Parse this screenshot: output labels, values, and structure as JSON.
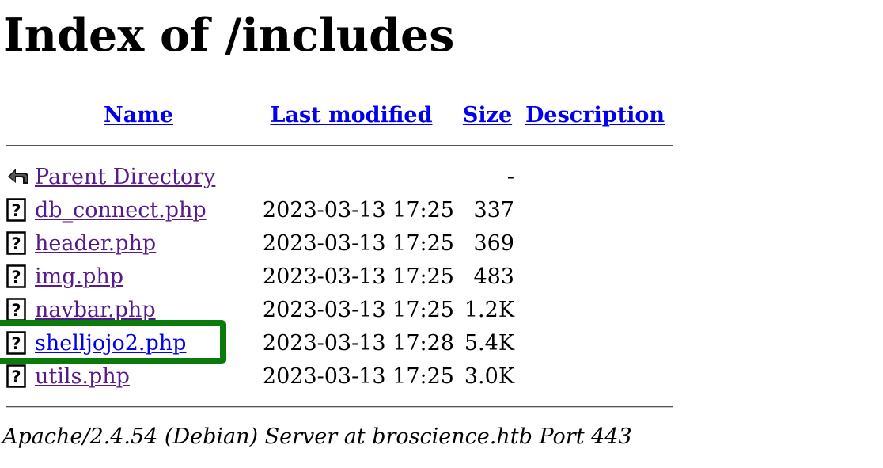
{
  "page": {
    "title": "Index of /includes"
  },
  "columns": {
    "name": "Name",
    "last_modified": "Last modified",
    "size": "Size",
    "description": "Description"
  },
  "rows": [
    {
      "icon": "back-arrow-icon",
      "name": "Parent Directory",
      "last_modified": "",
      "size": "-",
      "description": ""
    },
    {
      "icon": "unknown-file-icon",
      "name": "db_connect.php",
      "last_modified": "2023-03-13 17:25",
      "size": "337",
      "description": ""
    },
    {
      "icon": "unknown-file-icon",
      "name": "header.php",
      "last_modified": "2023-03-13 17:25",
      "size": "369",
      "description": ""
    },
    {
      "icon": "unknown-file-icon",
      "name": "img.php",
      "last_modified": "2023-03-13 17:25",
      "size": "483",
      "description": ""
    },
    {
      "icon": "unknown-file-icon",
      "name": "navbar.php",
      "last_modified": "2023-03-13 17:25",
      "size": "1.2K",
      "description": ""
    },
    {
      "icon": "unknown-file-icon",
      "name": "shelljojo2.php",
      "last_modified": "2023-03-13 17:28",
      "size": "5.4K",
      "description": ""
    },
    {
      "icon": "unknown-file-icon",
      "name": "utils.php",
      "last_modified": "2023-03-13 17:25",
      "size": "3.0K",
      "description": ""
    }
  ],
  "footer": {
    "server_signature": "Apache/2.4.54 (Debian) Server at broscience.htb Port 443"
  },
  "colors": {
    "link_visited": "#551a8b",
    "link_unvisited": "#0000ee",
    "highlight_box": "#0a7a0a"
  }
}
